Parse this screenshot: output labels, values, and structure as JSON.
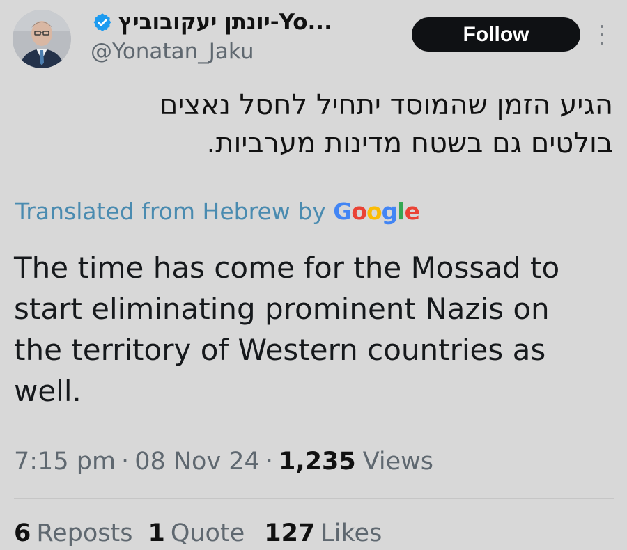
{
  "tweet": {
    "author": {
      "display_name": "יונתן יעקובוביץ-Yo...",
      "handle": "@Yonatan_Jaku",
      "verified": true
    },
    "follow_button_label": "Follow",
    "hebrew_text_line1": "הגיע הזמן שהמוסד יתחיל לחסל נאצים",
    "hebrew_text_line2": "בולטים גם בשטח מדינות מערביות.",
    "translated_prefix": "Translated from Hebrew by",
    "translated_brand": "Google",
    "translation": "The time has come for the Mossad to start eliminating prominent Nazis on the territory of Western countries as well.",
    "time": "7:15 pm",
    "date": "08 Nov 24",
    "views_count": "1,235",
    "views_label": "Views",
    "separator": "·",
    "reposts_count": "6",
    "reposts_label": "Reposts",
    "quotes_count": "1",
    "quotes_label": "Quote",
    "likes_count": "127",
    "likes_label": "Likes"
  },
  "icons": {
    "verified": "verified-badge-icon",
    "more": "more-vertical-icon"
  },
  "colors": {
    "background": "#d8d8d8",
    "follow_button": "#0f1114",
    "translation_link": "#4a8bb0",
    "verified": "#1d9bf0"
  }
}
